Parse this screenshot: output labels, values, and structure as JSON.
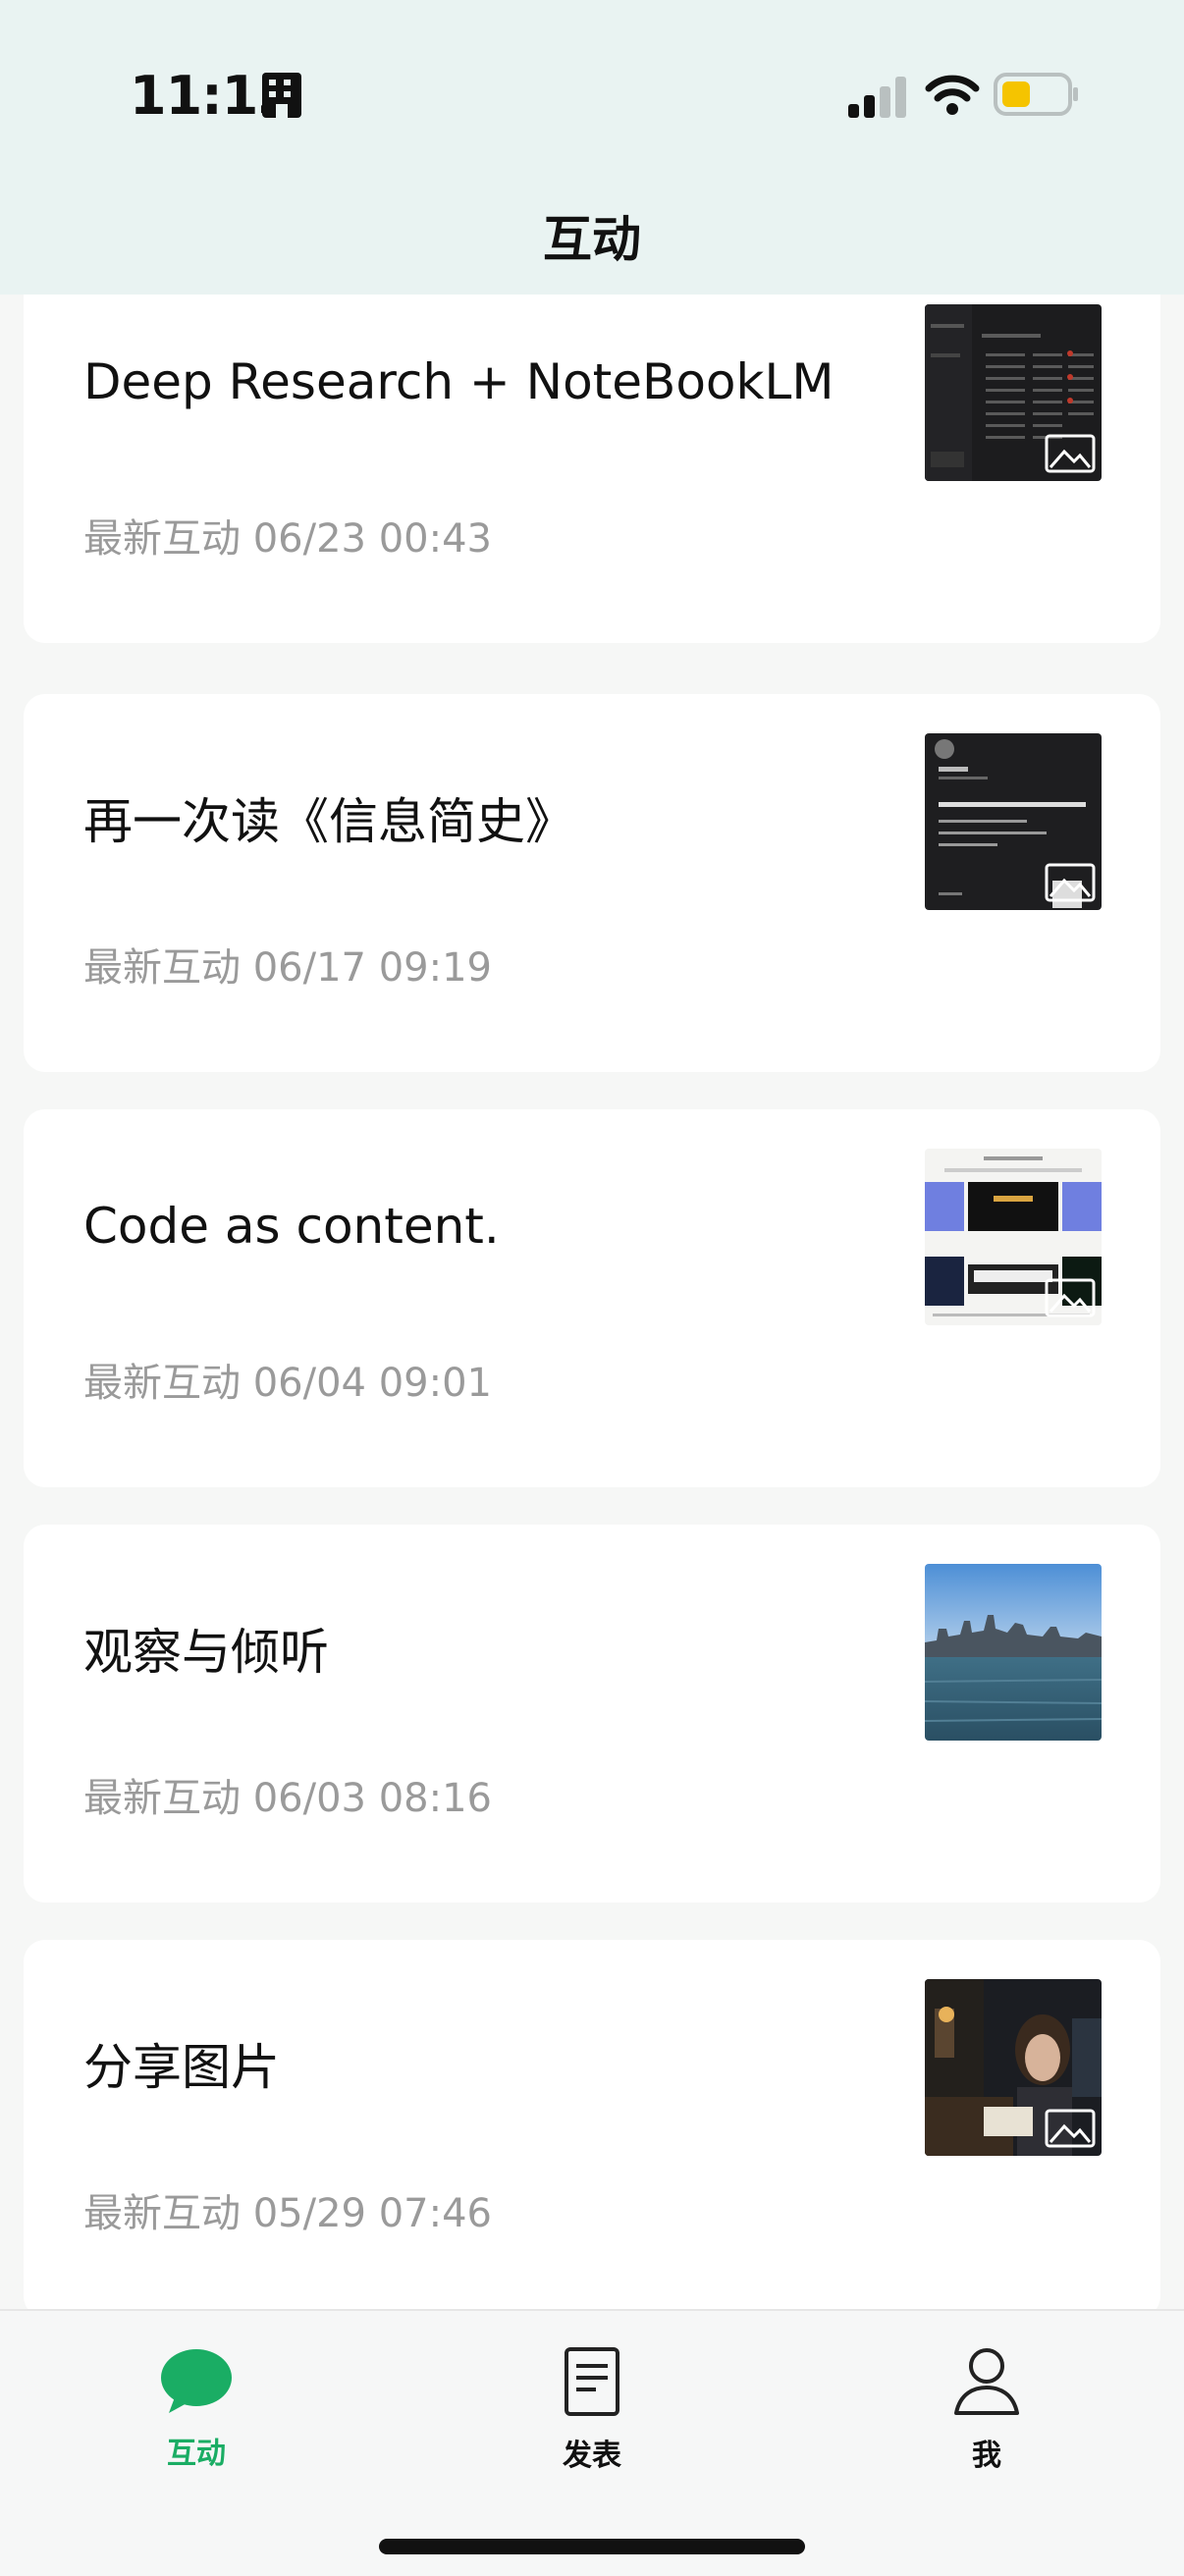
{
  "status_bar": {
    "time": "11:13",
    "time_icon": "building-icon",
    "signal_icon": "cellular-signal-icon",
    "wifi_icon": "wifi-icon",
    "battery_icon": "battery-low-icon",
    "battery_color": "#f5c400"
  },
  "header": {
    "title": "互动"
  },
  "posts": [
    {
      "title": "Deep Research + NoteBookLM",
      "meta": "最新互动 06/23 00:43",
      "thumb": "dark-ui-screenshot",
      "badge": "image-icon"
    },
    {
      "title": "再一次读《信息简史》",
      "meta": "最新互动 06/17 09:19",
      "thumb": "dark-text-card",
      "badge": "image-icon"
    },
    {
      "title": "Code as content.",
      "meta": "最新互动 06/04 09:01",
      "thumb": "collage-screenshot",
      "badge": "image-icon"
    },
    {
      "title": "观察与倾听",
      "meta": "最新互动 06/03 08:16",
      "thumb": "city-harbor-photo",
      "badge": ""
    },
    {
      "title": "分享图片",
      "meta": "最新互动 05/29 07:46",
      "thumb": "person-portrait-photo",
      "badge": "image-icon"
    }
  ],
  "tabbar": {
    "accent": "#1aad64",
    "tabs": [
      {
        "label": "互动",
        "icon": "chat-bubble-icon",
        "active": true
      },
      {
        "label": "发表",
        "icon": "document-icon",
        "active": false
      },
      {
        "label": "我",
        "icon": "person-icon",
        "active": false
      }
    ]
  }
}
